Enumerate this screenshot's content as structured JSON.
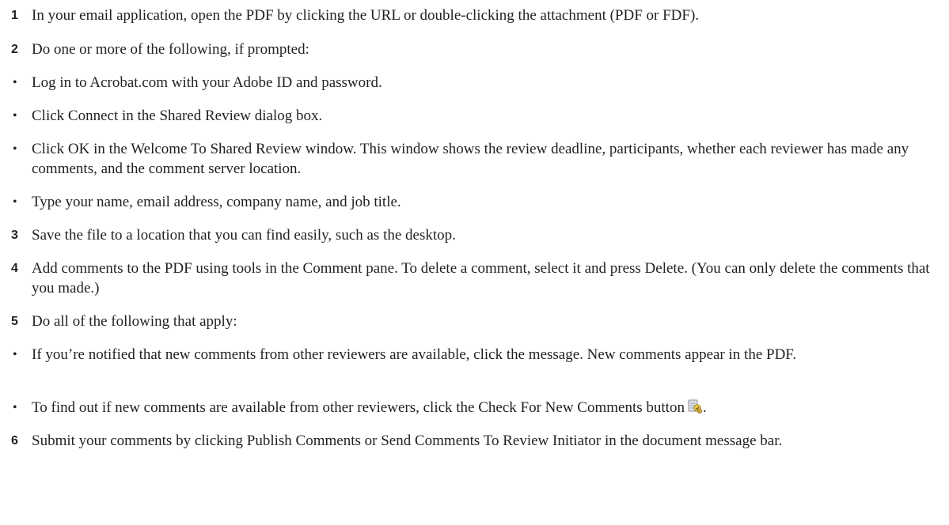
{
  "steps": [
    {
      "marker": "1",
      "kind": "num",
      "text": "In your email application, open the PDF by clicking the URL or double-clicking the attachment (PDF or FDF)."
    },
    {
      "marker": "2",
      "kind": "num",
      "text": "Do one or more of the following, if prompted:"
    },
    {
      "marker": "•",
      "kind": "bullet",
      "text": "Log in to Acrobat.com with your Adobe ID and password."
    },
    {
      "marker": "•",
      "kind": "bullet",
      "text": "Click Connect in the Shared Review dialog box."
    },
    {
      "marker": "•",
      "kind": "bullet",
      "text": "Click OK in the Welcome To Shared Review window. This window shows the review deadline, participants, whether each reviewer has made any comments, and the comment server location."
    },
    {
      "marker": "•",
      "kind": "bullet",
      "text": "Type your name, email address, company name, and job title."
    },
    {
      "marker": "3",
      "kind": "num",
      "text": "Save the file to a location that you can find easily, such as the desktop."
    },
    {
      "marker": "4",
      "kind": "num",
      "text": "Add comments to the PDF using tools in the Comment pane. To delete a comment, select it and press Delete. (You can only delete the comments that you made.)"
    },
    {
      "marker": "5",
      "kind": "num",
      "text": "Do all of the following that apply:"
    },
    {
      "marker": "•",
      "kind": "bullet",
      "text": "If you’re notified that new comments from other reviewers are available, click the message. New comments appear in the PDF."
    },
    {
      "marker": "•",
      "kind": "bullet",
      "text": "To find out if new comments are available from other reviewers, click the Check For New Comments button",
      "suffix": ".",
      "icon": "check-for-new-comments-icon"
    },
    {
      "marker": "6",
      "kind": "num",
      "text": "Submit your comments by clicking Publish Comments or Send Comments To Review Initiator in the document message bar."
    }
  ]
}
